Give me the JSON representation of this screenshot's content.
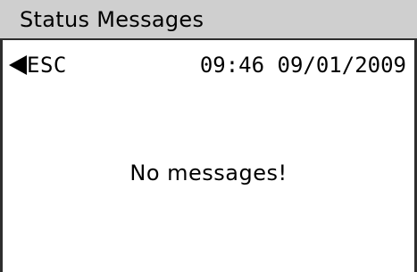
{
  "title_bar": {
    "title": "Status Messages"
  },
  "nav": {
    "back_icon": "left-triangle-arrow-icon",
    "back_label": "ESC"
  },
  "status": {
    "time": "09:46",
    "date": "09/01/2009",
    "datetime": "09:46 09/01/2009"
  },
  "content": {
    "empty_message": "No messages!"
  },
  "colors": {
    "title_bar_bg": "#cfcfcf",
    "frame": "#2e2e2e",
    "background": "#ffffff",
    "text": "#000000"
  }
}
